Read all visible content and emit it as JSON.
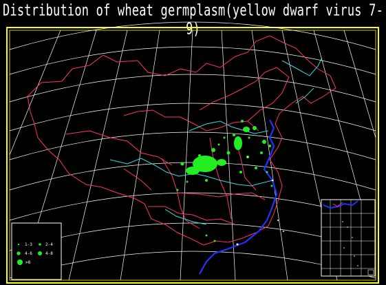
{
  "title": "Distribution of wheat germplasm(yellow dwarf virus 7-9)",
  "colors": {
    "background": "#000000",
    "frame": "#ffff00",
    "graticule": "#ffffff",
    "province_borders": "#ff3366",
    "rivers": "#33dddd",
    "coastline": "#2233ff",
    "points": "#22ee22"
  },
  "legend": {
    "items": [
      {
        "label": "1-3",
        "size": "small"
      },
      {
        "label": "4-6",
        "size": "medium"
      },
      {
        "label": ">8",
        "size": "large"
      },
      {
        "label": "2-4",
        "size": "small"
      },
      {
        "label": "4-8",
        "size": "medium"
      }
    ]
  },
  "inset": {
    "description_icon": "south-china-sea-inset-icon"
  }
}
